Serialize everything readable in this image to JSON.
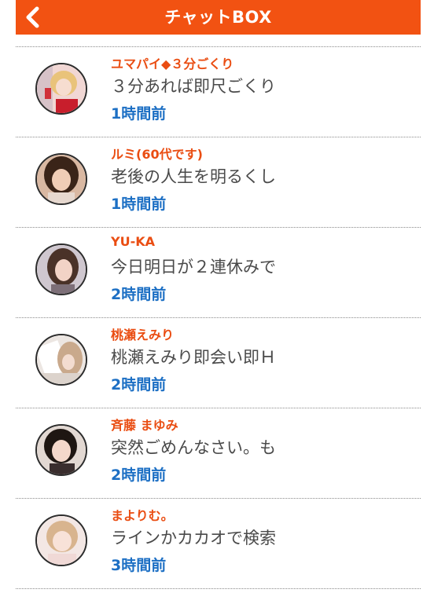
{
  "header": {
    "back_icon": "chevron-left-icon",
    "title": "チャットBOX"
  },
  "colors": {
    "header_bg": "#f25212",
    "name": "#ea4d12",
    "time": "#1c6fc4",
    "message": "#4a4a4a"
  },
  "chats": [
    {
      "name": "ユマパイ◆３分ごくり",
      "message": "３分あれば即尺ごくり",
      "time": "1時間前"
    },
    {
      "name": "ルミ(60代です)",
      "message": "老後の人生を明るくし",
      "time": "1時間前"
    },
    {
      "name": "YU-KA",
      "message": "今日明日が２連休みで",
      "time": "2時間前"
    },
    {
      "name": "桃瀬えみり",
      "message": "桃瀬えみり即会い即Ｈ",
      "time": "2時間前"
    },
    {
      "name": "斉藤 まゆみ",
      "message": "突然ごめんなさい。も",
      "time": "2時間前"
    },
    {
      "name": "まよりむ。",
      "message": "ラインかカカオで検索",
      "time": "3時間前"
    }
  ]
}
